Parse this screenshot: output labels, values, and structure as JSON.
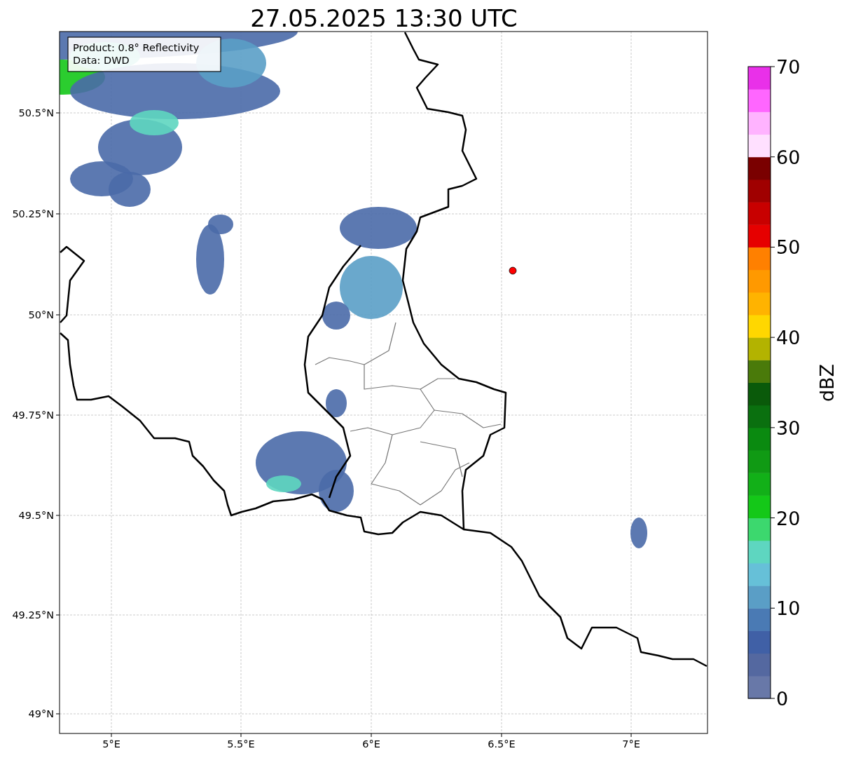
{
  "title": "27.05.2025 13:30 UTC",
  "info_box": {
    "lines": [
      "Product: 0.8° Reflectivity",
      "Data: DWD"
    ]
  },
  "map": {
    "yticks": [
      "50.5°N",
      "50.25°N",
      "50°N",
      "49.75°N",
      "49.5°N",
      "49.25°N",
      "49°N"
    ],
    "xticks": [
      "5°E",
      "5.5°E",
      "6°E",
      "6.5°E",
      "7°E"
    ],
    "marker": {
      "color": "#ff0000"
    }
  },
  "colorbar": {
    "label": "dBZ",
    "ticks": [
      "70",
      "60",
      "50",
      "40",
      "30",
      "20",
      "10",
      "0"
    ]
  }
}
